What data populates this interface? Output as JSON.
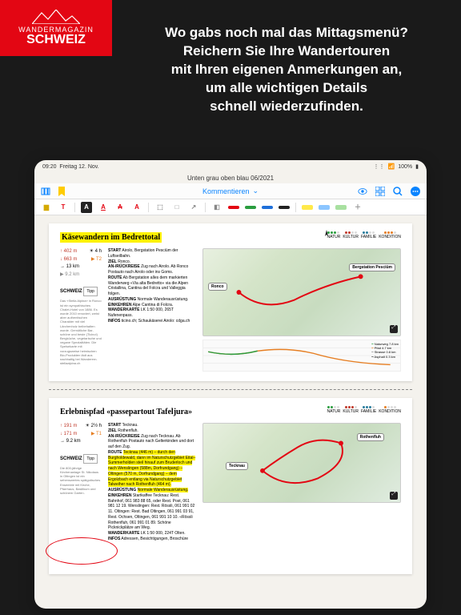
{
  "logo": {
    "line1": "WANDERMAGAZIN",
    "line2": "SCHWEIZ"
  },
  "headline": {
    "l1": "Wo gabs noch mal das Mittagsmenü?",
    "l2": "Reichern Sie Ihre Wandertouren",
    "l3": "mit Ihren eigenen Anmerkungen an,",
    "l4": "um alle wichtigen Details",
    "l5": "schnell wiederzufinden."
  },
  "statusbar": {
    "time": "09:20",
    "date": "Freitag 12. Nov.",
    "battery": "100%"
  },
  "window": {
    "title": "Unten grau oben blau 06/2021"
  },
  "toolbar": {
    "center_label": "Kommentieren"
  },
  "categories": {
    "c1": "NATUR",
    "c2": "KULTUR",
    "c3": "FAMILIE",
    "c4": "KONDITION"
  },
  "article1": {
    "title": "Käsewandern im Bedrettotal",
    "stats": {
      "up": "↑ 402 m",
      "dur": "☀ 4 h",
      "down": "↓ 663 m",
      "diff": "▶ T2",
      "dist": "→ 13 km",
      "extra": "▶ 9.2 km"
    },
    "tipp_label": "SCHWEIZ",
    "tipp_badge": "Tipp",
    "sidebar": "Das «Stella Alpina» in Ronco ist ein sympathisches Chalet-Hotel von 1886. Es wurde 2010 renoviert, weist aber authentischen Charakter mit viel Lärchenholz beibehalten wurde. Gemütliche Bar, schöne und beste (Ticino!) Bergküche, vegetarische und vegane Spezialitäten. Die Speisekarte mit vorzugsweise heimischen Bio-Produkten lädt aus nachhaltig bei Wanderern. stellaalpina.ch",
    "desc": {
      "start_l": "START",
      "start_v": "Airolo, Bergstation Pesciüm der Luftseilbahn.",
      "ziel_l": "ZIEL",
      "ziel_v": "Ronco.",
      "anr_l": "AN-/RÜCKREISE",
      "anr_v": "Zug nach Airolo. Ab Ronco Postauto nach Airolo oder ins Goms.",
      "route_l": "ROUTE",
      "route_v": "Ab Bergstation alles dem markierten Wanderweg «Via alta Bedretto» via die Alpen Cristallina, Cantina del Folcra und Valleggia folgen.",
      "ausr_l": "AUSRÜSTUNG",
      "ausr_v": "Normale Wanderausrüstung.",
      "eink_l": "EINKEHREN",
      "eink_v": "Alpe Cantina di Folcra.",
      "wand_l": "WANDERKARTE",
      "wand_v": "LK 1:50 000, 265T Nufenenpass.",
      "infos_l": "INFOS",
      "infos_v": "ticino.ch; Schaukäserei Airolo: cdga.ch"
    },
    "places": {
      "p1": "Ronco",
      "p2": "Bergstation Pesciüm"
    },
    "legend": {
      "a": "Naturweg 7.8 km",
      "b": "Pfad 4.7 km",
      "c": "Strasse 0.8 km",
      "d": "Asphalt 0.3 km"
    }
  },
  "article2": {
    "title": "Erlebnispfad «passepartout Tafeljura»",
    "stats": {
      "up": "↑ 191 m",
      "dur": "☀ 2½ h",
      "down": "↓ 171 m",
      "diff": "▶ T1",
      "dist": "→ 9.2 km"
    },
    "tipp_label": "SCHWEIZ",
    "tipp_badge": "Tipp",
    "sidebar": "Die 800-jährige Kirchenanlage St. Nikolaus in Oltingen ist ein sehenswertes spätgotisches Ensemble mit Kirche, Pfarrhaus, Basilikum und schönem Garten.",
    "desc": {
      "start_l": "START",
      "start_v": "Tecknau.",
      "ziel_l": "ZIEL",
      "ziel_v": "Rothenfluh.",
      "anr_l": "AN-/RÜCKREISE",
      "anr_v": "Zug nach Tecknau. Ab Rothenfluh Postauto nach Gelterkinden und dort auf den Zug.",
      "route_l": "ROUTE",
      "route_hl": "Tecknau (446 m) – durch den Burgholdewald, dann im Naturschutzgebiet Eital–Summerholden steil hinauf zum Bruderloch und nach Wenslingen (588m, Dorfrundgang) – Oltingen (570 m, Dorfrundgang) – dem Ergolzbach entlang via Naturschutzgebiet Talweiher nach Rothenfluh (464 m).",
      "ausr_l": "AUSRÜSTUNG",
      "ausr_v": "Normale Wanderausrüstung.",
      "eink_l": "EINKEHREN",
      "eink_v": "Startkaffee Tecknau: Rest. Bahnhof, 061 983 88 65, oder Rest. Post, 061 981 12 19. Wenslingen: Rest. Rössli, 061 991 02 11. Oltingen: Rest. Bad Oltingen, 061 991 03 91, Rest. Ochsen, Oltingen, 061 991 10 10. «Rössli Rothenfluh, 061 991 01 89. Schöne Picknickplätze am Weg.",
      "wand_l": "WANDERKARTE",
      "wand_v": "LK 1:50 000, 224T Olten.",
      "infos_l": "INFOS",
      "infos_v": "Adressen, Besichtigungen, Broschüre"
    },
    "places": {
      "p1": "Rothenfluh",
      "p2": "Tecknau"
    }
  }
}
